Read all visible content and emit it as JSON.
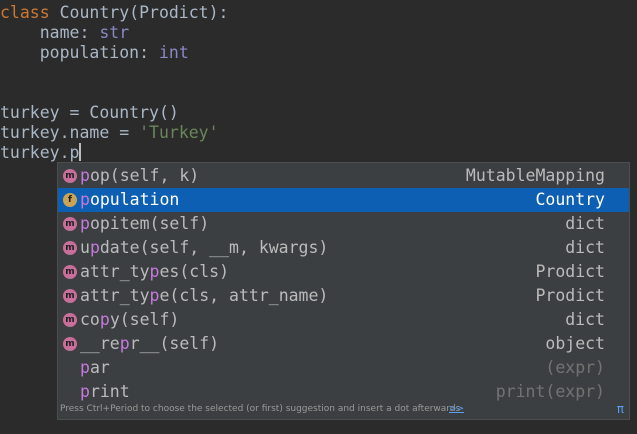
{
  "editor": {
    "lines": {
      "l1": {
        "keyword": "class",
        "rest": " Country(Prodict):"
      },
      "l2": {
        "prefix": "    name: ",
        "type": "str"
      },
      "l3": {
        "prefix": "    population: ",
        "type": "int"
      },
      "l4": {
        "text": "turkey = Country()"
      },
      "l5": {
        "prefix": "turkey.name = ",
        "string": "'Turkey'"
      },
      "l6": {
        "text": "turkey.p"
      }
    }
  },
  "completion": {
    "selected_index": 1,
    "items": [
      {
        "icon": "m",
        "pre": "",
        "match": "p",
        "post": "op(self, k)",
        "type": "MutableMapping"
      },
      {
        "icon": "f",
        "pre": "",
        "match": "p",
        "post": "opulation",
        "type": "Country"
      },
      {
        "icon": "m",
        "pre": "",
        "match": "p",
        "post": "opitem(self)",
        "type": "dict"
      },
      {
        "icon": "m",
        "pre": "u",
        "match": "p",
        "post": "date(self, __m, kwargs)",
        "type": "dict"
      },
      {
        "icon": "m",
        "pre": "attr_ty",
        "match": "p",
        "post": "es(cls)",
        "type": "Prodict"
      },
      {
        "icon": "m",
        "pre": "attr_ty",
        "match": "p",
        "post": "e(cls, attr_name)",
        "type": "Prodict"
      },
      {
        "icon": "m",
        "pre": "co",
        "match": "p",
        "post": "y(self)",
        "type": "dict"
      },
      {
        "icon": "m",
        "pre": "__re",
        "match": "p",
        "post": "r__(self)",
        "type": "object"
      },
      {
        "icon": "",
        "pre": "",
        "match": "p",
        "post": "ar",
        "type": "(expr)"
      },
      {
        "icon": "",
        "pre": "",
        "match": "p",
        "post": "rint",
        "type": "print(expr)"
      }
    ],
    "hint": "Press Ctrl+Period to choose the selected (or first) suggestion and insert a dot afterwards",
    "hint_link": ">>",
    "pi": "π"
  }
}
